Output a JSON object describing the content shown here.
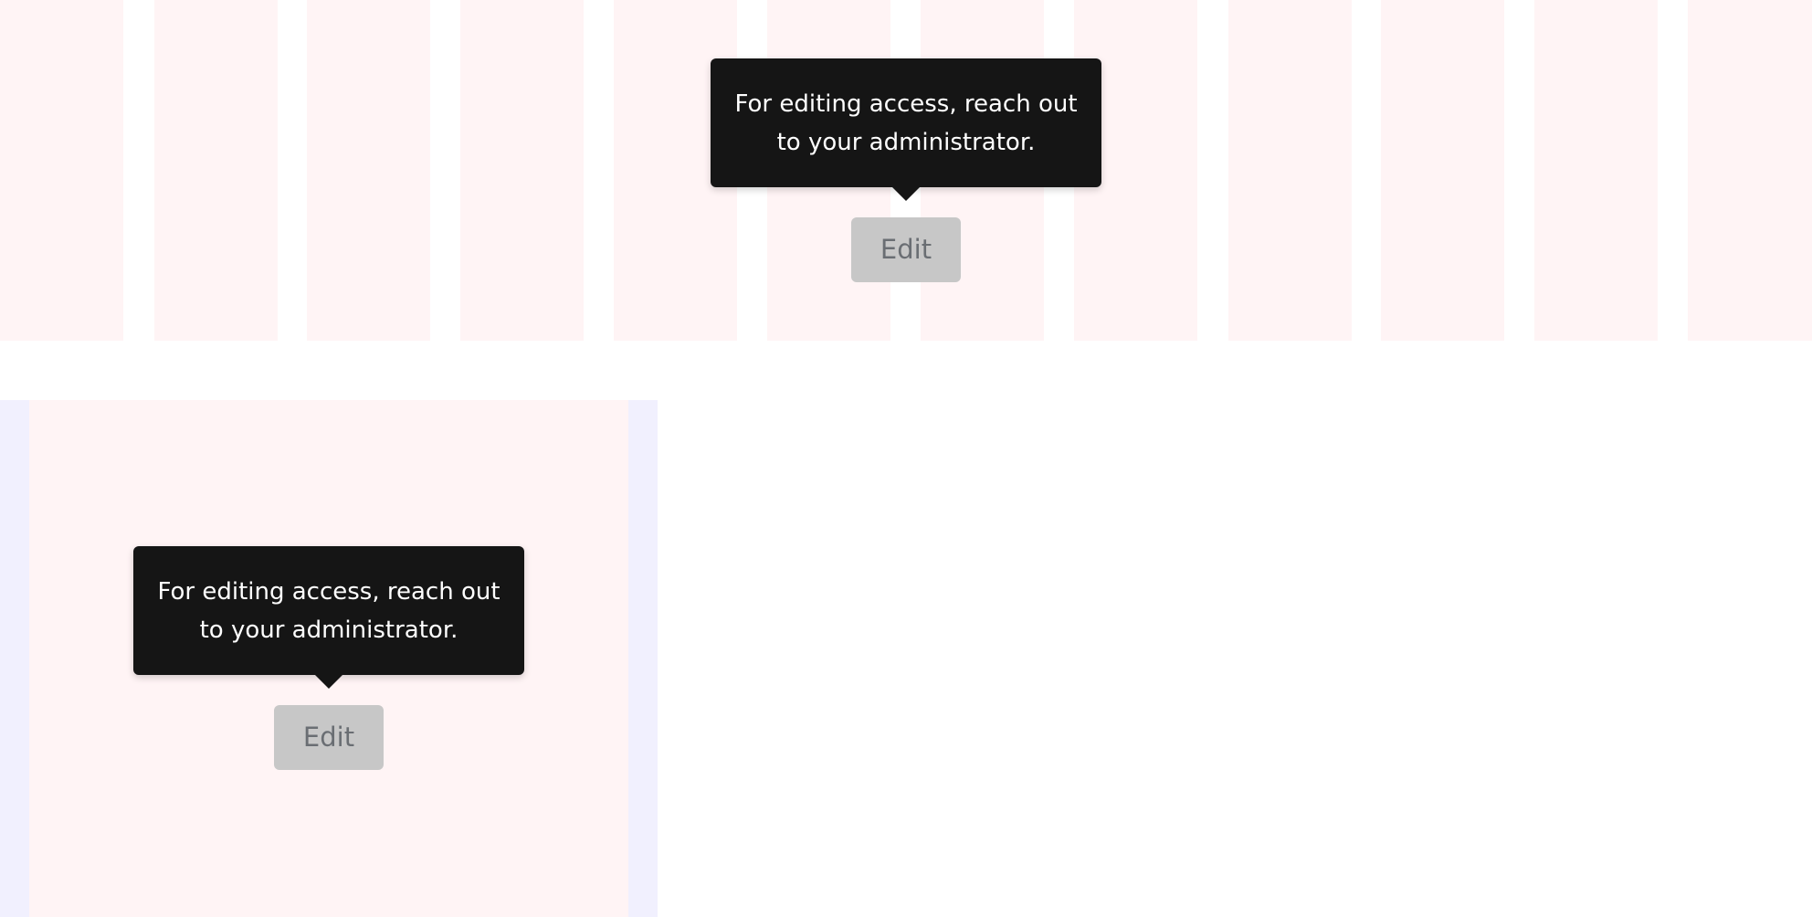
{
  "colors": {
    "column_fill": "#fff4f5",
    "panel_border": "#f1f0fe",
    "tooltip_bg": "#151515",
    "tooltip_text": "#ffffff",
    "button_disabled_bg": "#c7c7c7",
    "button_disabled_text": "#6a6e73"
  },
  "examples": [
    {
      "tooltip": {
        "line1": "For editing access, reach out",
        "line2": "to your administrator."
      },
      "button": {
        "label": "Edit",
        "state": "disabled"
      }
    },
    {
      "tooltip": {
        "line1": "For editing access, reach out",
        "line2": "to your administrator."
      },
      "button": {
        "label": "Edit",
        "state": "disabled"
      }
    }
  ]
}
